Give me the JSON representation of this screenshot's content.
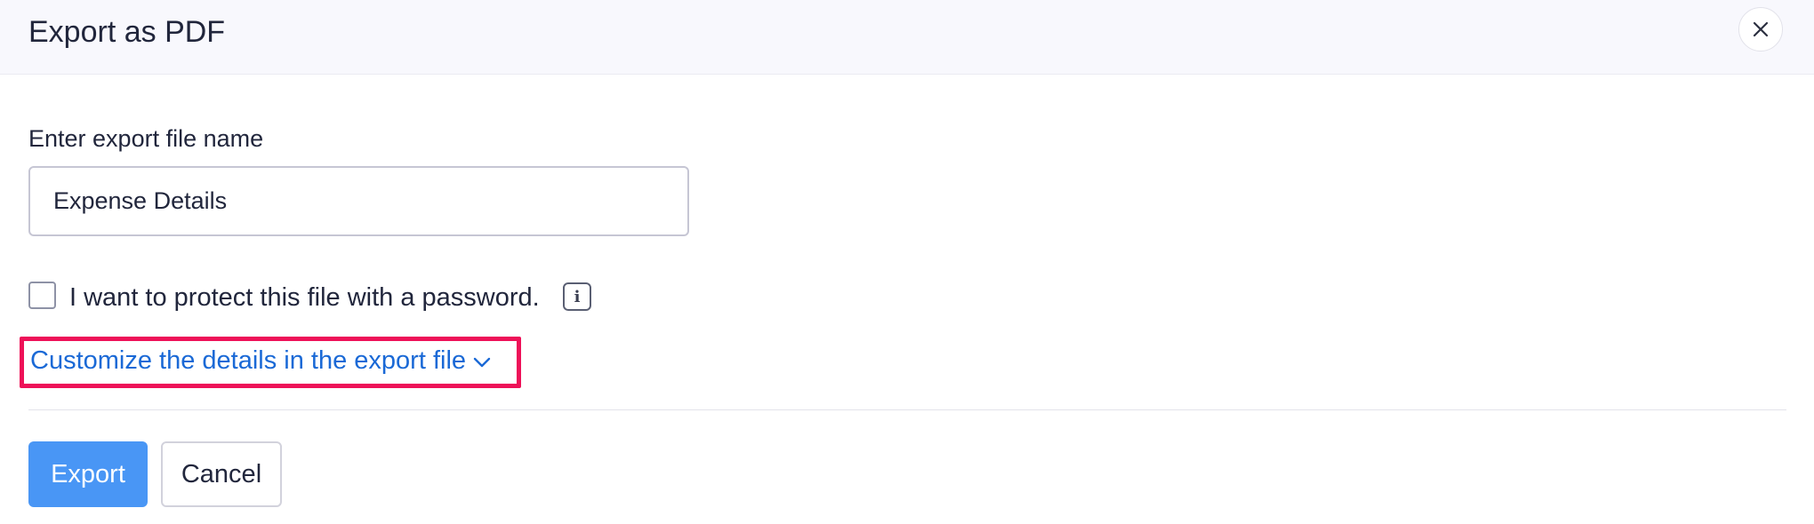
{
  "dialog": {
    "title": "Export as PDF",
    "close_icon": "close-icon"
  },
  "form": {
    "filename_label": "Enter export file name",
    "filename_value": "Expense Details",
    "password_checkbox_label": "I want to protect this file with a password.",
    "password_checked": false,
    "info_icon": "info-icon",
    "info_glyph": "i",
    "customize_link": "Customize the details in the export file",
    "customize_icon": "chevron-down-icon"
  },
  "actions": {
    "export_label": "Export",
    "cancel_label": "Cancel"
  },
  "colors": {
    "primary": "#4996f5",
    "link": "#1a69d6",
    "highlight": "#ee1158",
    "header_bg": "#f8f8fd"
  }
}
